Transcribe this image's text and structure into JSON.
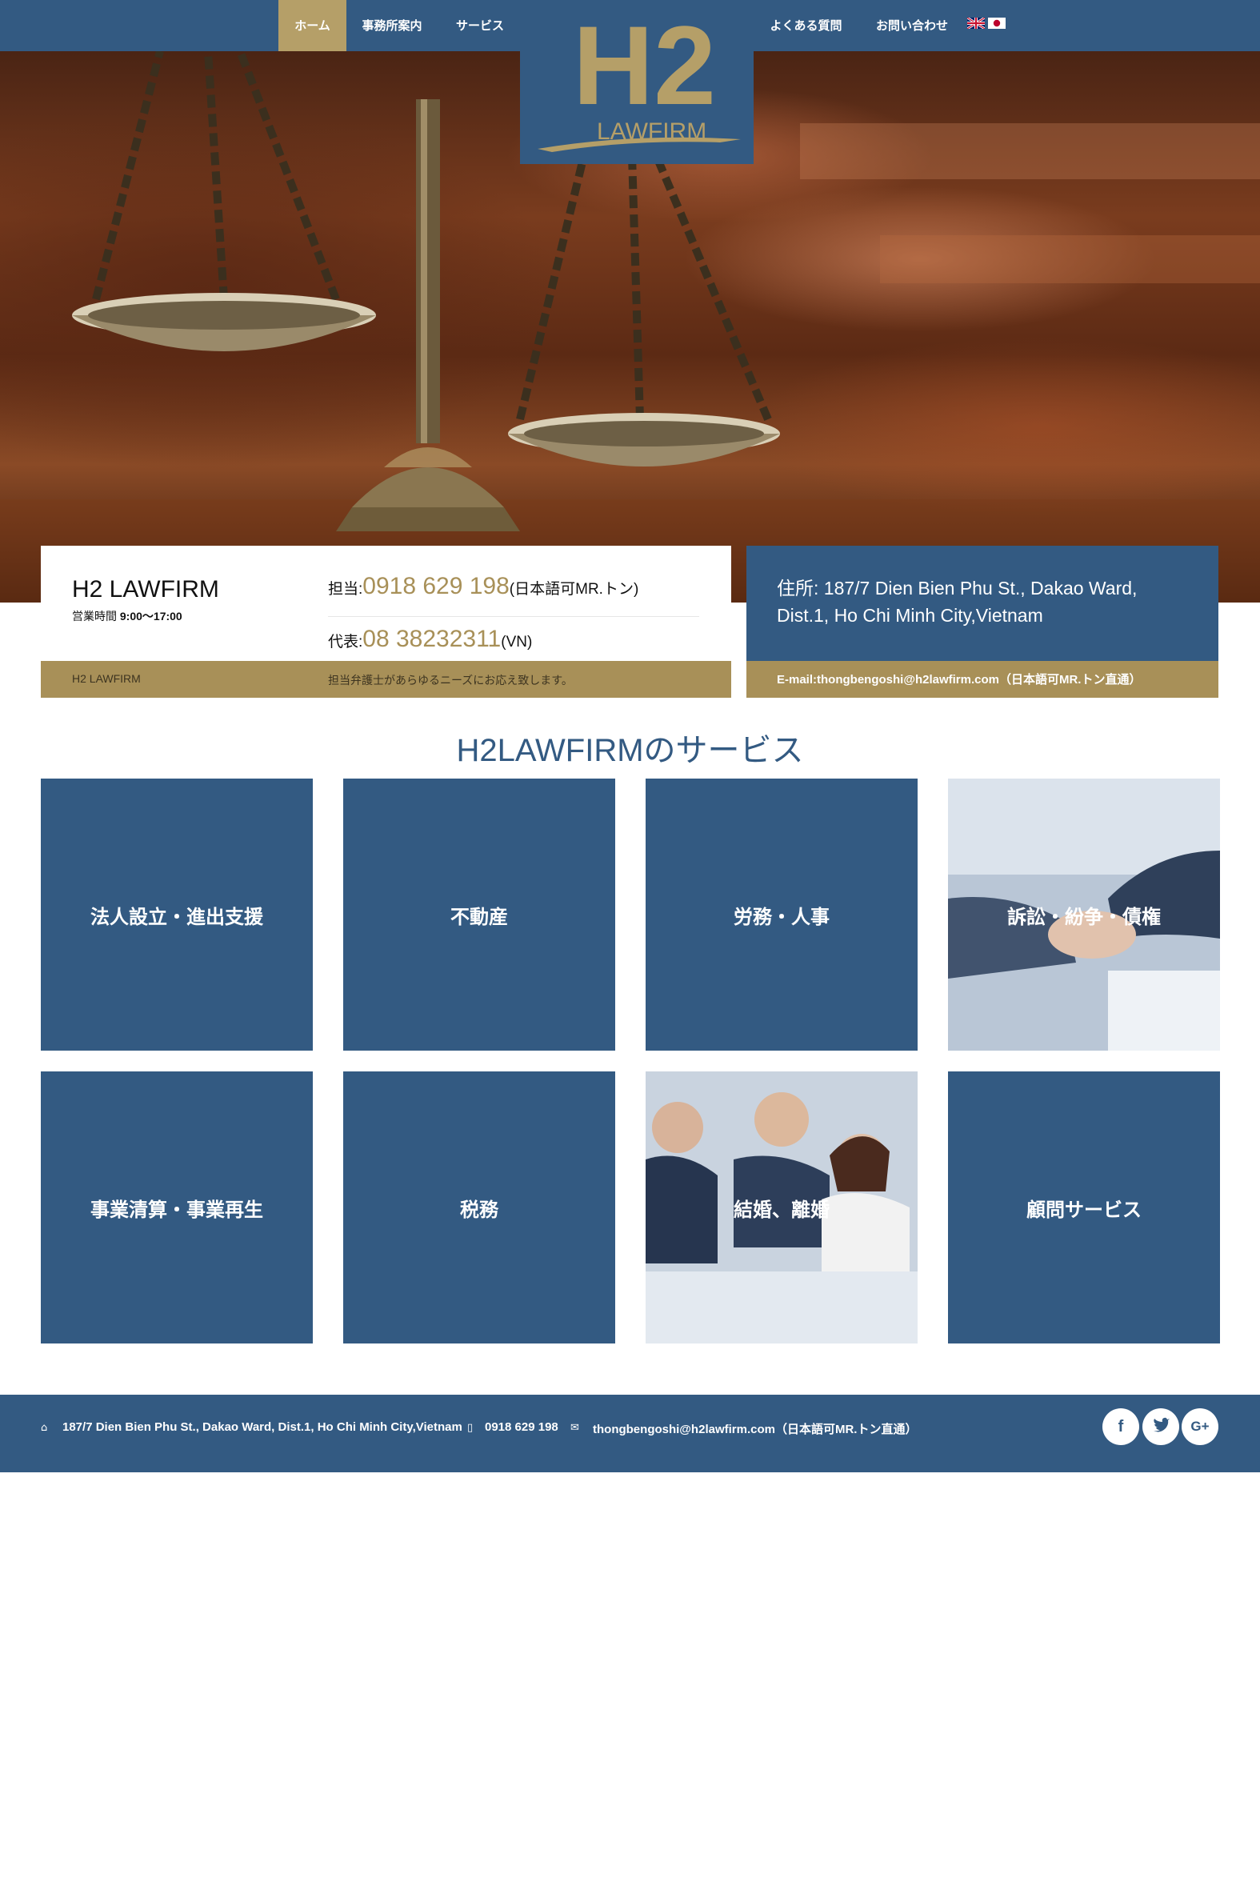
{
  "nav": {
    "home": "ホーム",
    "about": "事務所案内",
    "services": "サービス",
    "faq": "よくある質問",
    "contact": "お問い合わせ",
    "flags": [
      "uk-flag-icon",
      "japan-flag-icon"
    ]
  },
  "logo": {
    "mark": "H2",
    "text": "LAWFIRM"
  },
  "info": {
    "firm_name": "H2 LAWFIRM",
    "hours_label": "営業時間",
    "hours_value": "9:00〜17:00",
    "contact1_label": "担当:",
    "contact1_number": "0918 629 198",
    "contact1_note": "(日本語可MR.トン)",
    "contact2_label": "代表:",
    "contact2_number": "08 38232311",
    "contact2_note": "(VN)",
    "bar_left": "H2 LAWFIRM",
    "bar_tagline": "担当弁護士があらゆるニーズにお応え致します。",
    "address": "住所: 187/7 Dien Bien Phu St., Dakao Ward, Dist.1, Ho Chi Minh City,Vietnam",
    "email": "E-mail:thongbengoshi@h2lawfirm.com（日本語可MR.トン直通）"
  },
  "services": {
    "title": "H2LAWFIRMのサービス",
    "items": [
      "法人設立・進出支援",
      "不動産",
      "労務・人事",
      "訴訟・紛争・債権",
      "事業清算・事業再生",
      "税務",
      "結婚、離婚",
      "顧問サービス"
    ]
  },
  "footer": {
    "address": "187/7 Dien Bien Phu St., Dakao Ward, Dist.1, Ho Chi Minh City,Vietnam",
    "phone": "0918 629 198",
    "email": "thongbengoshi@h2lawfirm.com（日本語可MR.トン直通）",
    "social": [
      "facebook-icon",
      "twitter-icon",
      "google-plus-icon"
    ]
  },
  "colors": {
    "primary": "#335a82",
    "gold": "#a89058",
    "nav_active": "#b59f68"
  }
}
